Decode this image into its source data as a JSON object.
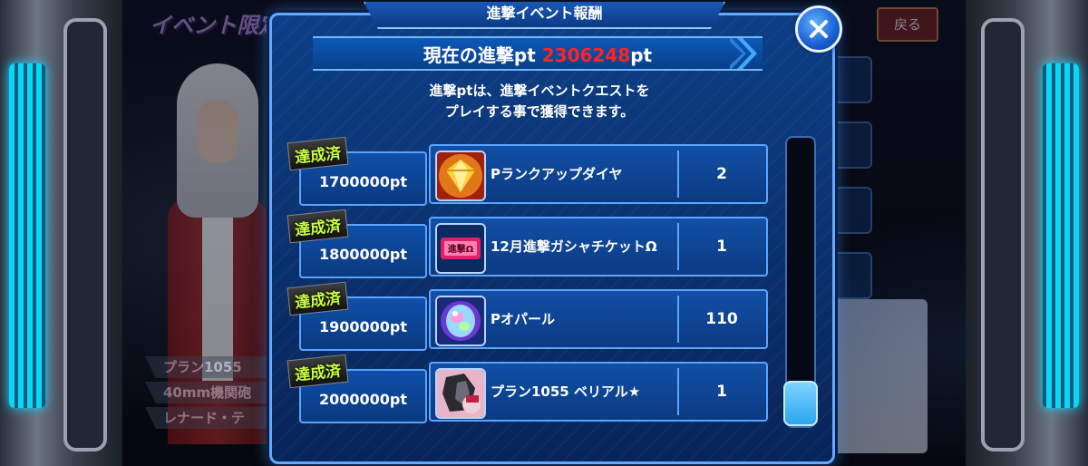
{
  "background": {
    "title_fragment": "イベント限定",
    "back_button": "戻る",
    "list_items": [
      "プラン1055",
      "40mm機関砲",
      "レナード・テ"
    ]
  },
  "modal": {
    "title": "進撃イベント報酬",
    "current_label": "現在の進撃pt",
    "current_value": "2306248",
    "current_suffix": "pt",
    "description_line1": "進撃ptは、進撃イベントクエストを",
    "description_line2": "プレイする事で獲得できます。",
    "rows": [
      {
        "badge": "達成済",
        "points": "1700000pt",
        "item": "Pランクアップダイヤ",
        "quantity": "2"
      },
      {
        "badge": "達成済",
        "points": "1800000pt",
        "item": "12月進撃ガシャチケットΩ",
        "quantity": "1"
      },
      {
        "badge": "達成済",
        "points": "1900000pt",
        "item": "Pオパール",
        "quantity": "110"
      },
      {
        "badge": "達成済",
        "points": "2000000pt",
        "item": "プラン1055 ベリアル★",
        "quantity": "1"
      }
    ],
    "ticket_icon_text": "進撃Ω"
  },
  "colors": {
    "modal_bg": "#0d3f86",
    "accent_border": "#62a9ff",
    "points_red": "#ff2323",
    "badge_green": "#c8ff3a"
  },
  "icons": [
    "close-icon",
    "diamond-icon",
    "ticket-icon",
    "opal-icon",
    "unit-portrait-icon"
  ]
}
